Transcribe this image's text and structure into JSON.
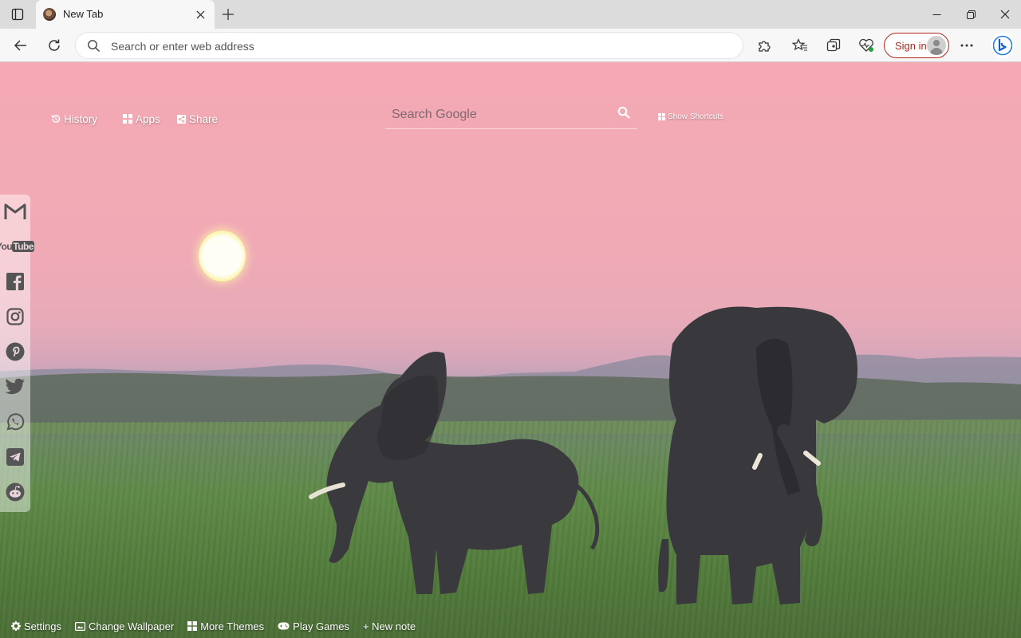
{
  "browser": {
    "tab": {
      "title": "New Tab"
    },
    "address": {
      "placeholder": "Search or enter web address",
      "value": ""
    },
    "signin_label": "Sign in"
  },
  "newtab": {
    "top_links": [
      {
        "label": "History",
        "icon": "history-icon"
      },
      {
        "label": "Apps",
        "icon": "apps-grid-icon"
      },
      {
        "label": "Share",
        "icon": "share-icon"
      }
    ],
    "search": {
      "placeholder": "Search Google"
    },
    "shortcuts_label": "Show Shortcuts",
    "social": [
      "gmail-icon",
      "youtube-icon",
      "facebook-icon",
      "instagram-icon",
      "pinterest-icon",
      "twitter-icon",
      "whatsapp-icon",
      "telegram-icon",
      "reddit-icon"
    ],
    "youtube_wordmark": {
      "a": "You",
      "b": "Tube"
    },
    "bottom": [
      {
        "label": "Settings",
        "icon": "gear-icon"
      },
      {
        "label": "Change Wallpaper",
        "icon": "wallpaper-icon"
      },
      {
        "label": "More Themes",
        "icon": "themes-grid-icon"
      },
      {
        "label": "Play Games",
        "icon": "gamepad-icon"
      },
      {
        "label": "+ New note",
        "icon": ""
      }
    ]
  },
  "colors": {
    "signin_accent": "#b3261e",
    "sky": "#f4a9b3",
    "grass": "#5f8a48"
  }
}
